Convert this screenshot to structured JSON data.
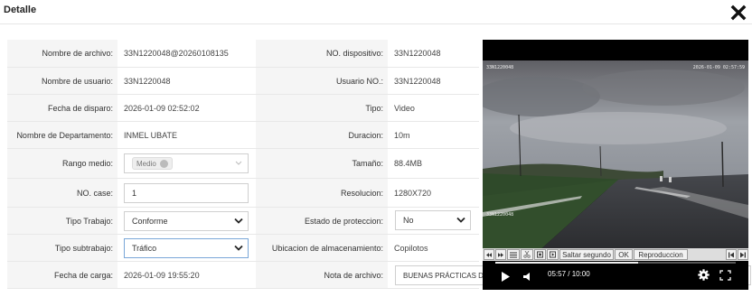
{
  "dialog": {
    "title": "Detalle"
  },
  "fields": {
    "nombre_archivo": {
      "label": "Nombre de archivo:",
      "value": "33N1220048@20260108135"
    },
    "no_dispositivo": {
      "label": "NO. dispositivo:",
      "value": "33N1220048"
    },
    "nombre_usuario": {
      "label": "Nombre de usuario:",
      "value": "33N1220048"
    },
    "usuario_no": {
      "label": "Usuario NO.:",
      "value": "33N1220048"
    },
    "fecha_disparo": {
      "label": "Fecha de disparo:",
      "value": "2026-01-09 02:52:02"
    },
    "tipo": {
      "label": "Tipo:",
      "value": "Video"
    },
    "departamento": {
      "label": "Nombre de Departamento:",
      "value": "INMEL UBATE"
    },
    "duracion": {
      "label": "Duracion:",
      "value": "10m"
    },
    "rango_medio": {
      "label": "Rango medio:",
      "value": "Medio"
    },
    "tamano": {
      "label": "Tamaño:",
      "value": "88.4MB"
    },
    "no_case": {
      "label": "NO. case:",
      "value": "1"
    },
    "resolucion": {
      "label": "Resolucion:",
      "value": "1280X720"
    },
    "tipo_trabajo": {
      "label": "Tipo Trabajo:",
      "value": "Conforme"
    },
    "estado_proteccion": {
      "label": "Estado de proteccion:",
      "value": "No"
    },
    "tipo_subtrabajo": {
      "label": "Tipo subtrabajo:",
      "value": "Tráfico"
    },
    "ubicacion": {
      "label": "Ubicacion de almacenamiento:",
      "value": "Copilotos"
    },
    "fecha_carga": {
      "label": "Fecha de carga:",
      "value": "2026-01-09 19:55:20"
    },
    "nota_archivo": {
      "label": "Nota de archivo:",
      "value": "BUENAS PRÁCTICAS DE CONDUCCIÓN - diego ortega"
    }
  },
  "player": {
    "time": "05:57 / 10:00",
    "progress_fraction": 0.595,
    "overlay_left": "33N1220048",
    "overlay_right": "2026-01-09 02:57:59",
    "overlay_bottom": "33N1220048",
    "toolbar": {
      "saltar_label": "Saltar segundo",
      "ok_label": "OK",
      "reproduccion_label": "Reproduccion"
    }
  },
  "icons": {
    "close": "close-icon",
    "play": "play-icon",
    "volume": "volume-icon",
    "settings": "gear-icon",
    "fullscreen": "fullscreen-icon"
  },
  "colors": {
    "accent_border": "#7aa7d8",
    "label_bg": "#f5f5f5"
  }
}
